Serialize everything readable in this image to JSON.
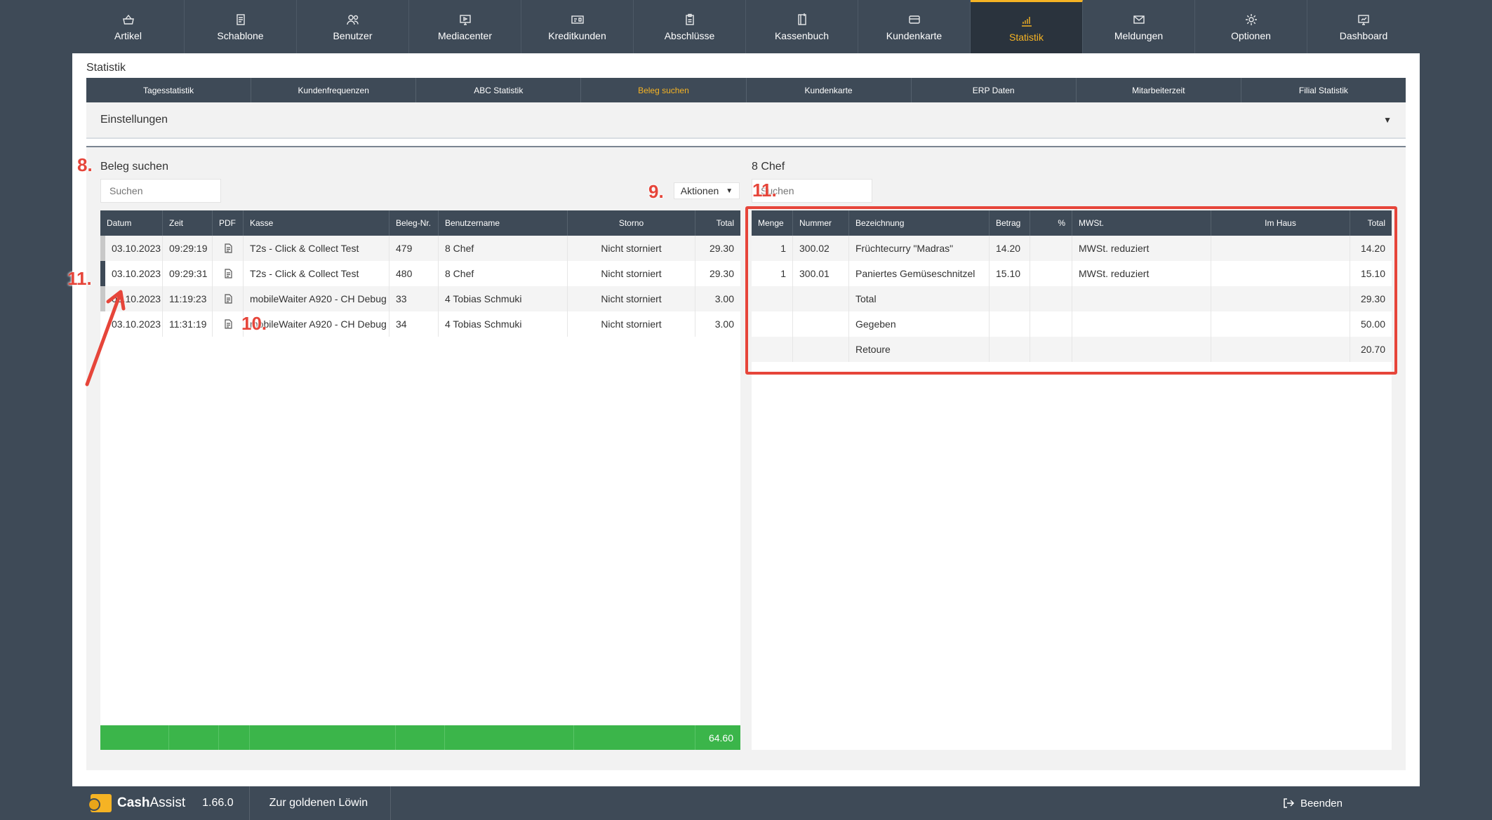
{
  "nav": [
    {
      "label": "Artikel",
      "icon": "basket-icon"
    },
    {
      "label": "Schablone",
      "icon": "template-icon"
    },
    {
      "label": "Benutzer",
      "icon": "users-icon"
    },
    {
      "label": "Mediacenter",
      "icon": "monitor-icon"
    },
    {
      "label": "Kreditkunden",
      "icon": "id-card-icon"
    },
    {
      "label": "Abschlüsse",
      "icon": "clipboard-icon"
    },
    {
      "label": "Kassenbuch",
      "icon": "book-icon"
    },
    {
      "label": "Kundenkarte",
      "icon": "card-icon"
    },
    {
      "label": "Statistik",
      "icon": "chart-icon",
      "active": true
    },
    {
      "label": "Meldungen",
      "icon": "mail-icon"
    },
    {
      "label": "Optionen",
      "icon": "gear-icon"
    },
    {
      "label": "Dashboard",
      "icon": "dashboard-icon"
    }
  ],
  "page_title": "Statistik",
  "subtabs": [
    "Tagesstatistik",
    "Kundenfrequenzen",
    "ABC Statistik",
    "Beleg suchen",
    "Kundenkarte",
    "ERP Daten",
    "Mitarbeiterzeit",
    "Filial Statistik"
  ],
  "active_subtab": "Beleg suchen",
  "settings": {
    "label": "Einstellungen",
    "caret": "▼"
  },
  "left": {
    "title": "Beleg suchen",
    "search_placeholder": "Suchen",
    "actions_label": "Aktionen",
    "columns": [
      "Datum",
      "Zeit",
      "PDF",
      "Kasse",
      "Beleg-Nr.",
      "Benutzername",
      "Storno",
      "Total"
    ],
    "rows": [
      {
        "datum": "03.10.2023",
        "zeit": "09:29:19",
        "kasse": "T2s - Click & Collect Test",
        "beleg": "479",
        "user": "8 Chef",
        "storno": "Nicht storniert",
        "total": "29.30"
      },
      {
        "datum": "03.10.2023",
        "zeit": "09:29:31",
        "kasse": "T2s - Click & Collect Test",
        "beleg": "480",
        "user": "8 Chef",
        "storno": "Nicht storniert",
        "total": "29.30"
      },
      {
        "datum": "03.10.2023",
        "zeit": "11:19:23",
        "kasse": "mobileWaiter A920 - CH Debug",
        "beleg": "33",
        "user": "4 Tobias Schmuki",
        "storno": "Nicht storniert",
        "total": "3.00"
      },
      {
        "datum": "03.10.2023",
        "zeit": "11:31:19",
        "kasse": "mobileWaiter A920 - CH Debug",
        "beleg": "34",
        "user": "4 Tobias Schmuki",
        "storno": "Nicht storniert",
        "total": "3.00"
      }
    ],
    "sum_total": "64.60"
  },
  "right": {
    "title": "8 Chef",
    "search_placeholder": "Suchen",
    "columns": [
      "Menge",
      "Nummer",
      "Bezeichnung",
      "Betrag",
      "%",
      "MWSt.",
      "Im Haus",
      "Total"
    ],
    "rows": [
      {
        "menge": "1",
        "nummer": "300.02",
        "bez": "Früchtecurry \"Madras\"",
        "betrag": "14.20",
        "pct": "",
        "mwst": "MWSt. reduziert",
        "haus": "",
        "total": "14.20"
      },
      {
        "menge": "1",
        "nummer": "300.01",
        "bez": "Paniertes Gemüseschnitzel",
        "betrag": "15.10",
        "pct": "",
        "mwst": "MWSt. reduziert",
        "haus": "",
        "total": "15.10"
      },
      {
        "menge": "",
        "nummer": "",
        "bez": "Total",
        "betrag": "",
        "pct": "",
        "mwst": "",
        "haus": "",
        "total": "29.30"
      },
      {
        "menge": "",
        "nummer": "",
        "bez": "Gegeben",
        "betrag": "",
        "pct": "",
        "mwst": "",
        "haus": "",
        "total": "50.00"
      },
      {
        "menge": "",
        "nummer": "",
        "bez": "Retoure",
        "betrag": "",
        "pct": "",
        "mwst": "",
        "haus": "",
        "total": "20.70"
      }
    ]
  },
  "annotations": [
    "8.",
    "9.",
    "10.",
    "11.",
    "11."
  ],
  "bottom": {
    "brand_a": "Cash",
    "brand_b": "Assist",
    "version": "1.66.0",
    "shop": "Zur goldenen Löwin",
    "logout": "Beenden"
  },
  "colors": {
    "nav_bg": "#3e4a57",
    "accent": "#f5b324",
    "total_green": "#3bb54a",
    "annotation_red": "#e6453a"
  }
}
